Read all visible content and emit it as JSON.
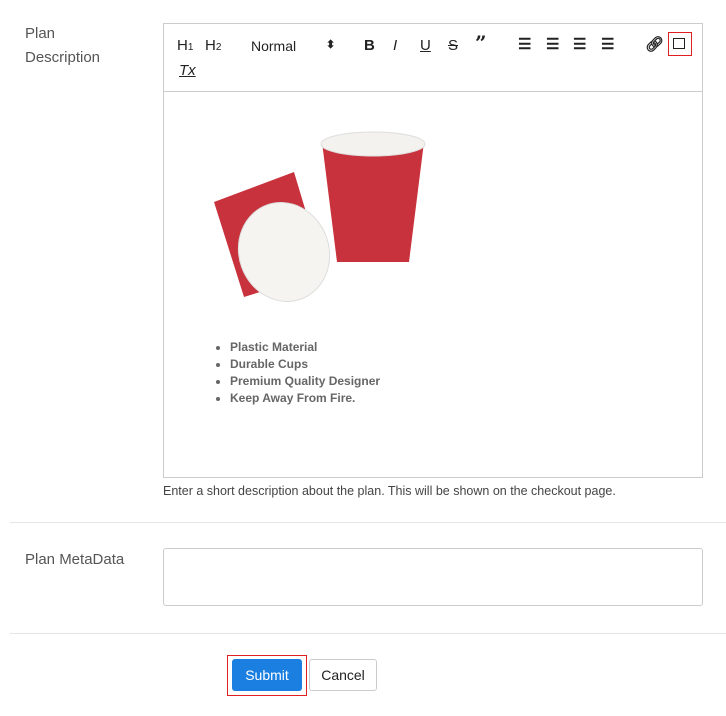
{
  "description": {
    "label_line1": "Plan",
    "label_line2": "Description",
    "toolbar": {
      "h1": "H1",
      "h2": "H2",
      "format": "Normal",
      "bold": "B",
      "italic": "I",
      "underline": "U",
      "strike": "S",
      "quote": "99",
      "clear": "Tx"
    },
    "bullets": [
      "Plastic Material",
      "Durable Cups",
      "Premium Quality Designer",
      "Keep Away From Fire."
    ],
    "help": "Enter a short description about the plan. This will be shown on the checkout page."
  },
  "metadata": {
    "label": "Plan MetaData",
    "value": ""
  },
  "actions": {
    "submit": "Submit",
    "cancel": "Cancel"
  },
  "colors": {
    "accent": "#1a7fe0",
    "highlight": "#e02020",
    "cup": "#c8323c"
  }
}
